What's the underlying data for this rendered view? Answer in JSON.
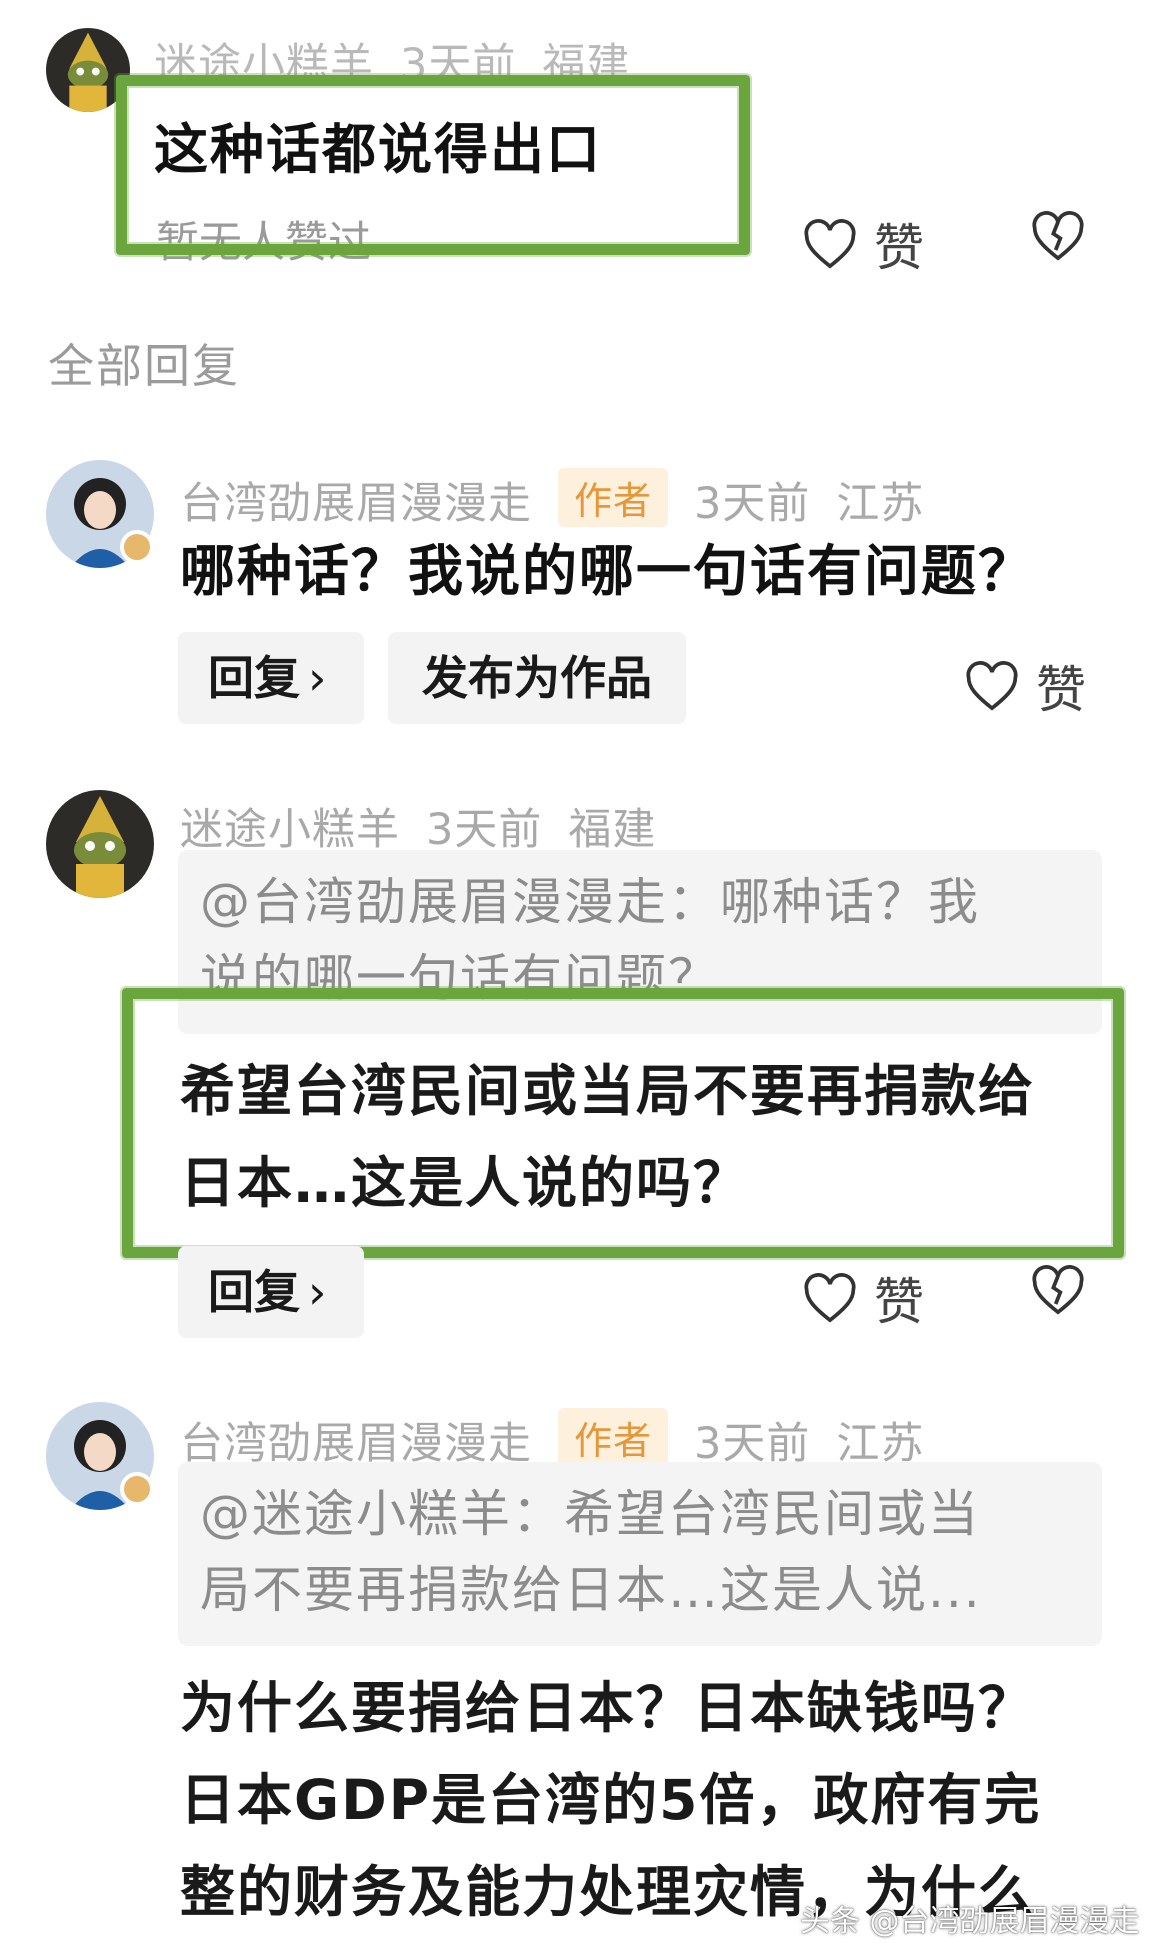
{
  "top_comment": {
    "user": "迷途小糕羊",
    "time": "3天前",
    "location": "福建",
    "text": "这种话都说得出口",
    "likes_text": "暂无人赞过",
    "like_label": "赞"
  },
  "section_title": "全部回复",
  "replies": [
    {
      "user": "台湾劭展眉漫漫走",
      "tag": "作者",
      "time": "3天前",
      "location": "江苏",
      "text": "哪种话？我说的哪一句话有问题？",
      "reply_label": "回复",
      "publish_label": "发布为作品",
      "like_label": "赞"
    },
    {
      "user": "迷途小糕羊",
      "time": "3天前",
      "location": "福建",
      "quote_line1": "@台湾劭展眉漫漫走：哪种话？我",
      "quote_line2": "说的哪一句话有问题？",
      "text_line1": "希望台湾民间或当局不要再捐款给",
      "text_line2": "日本…这是人说的吗？",
      "reply_label": "回复",
      "like_label": "赞"
    },
    {
      "user": "台湾劭展眉漫漫走",
      "tag": "作者",
      "time": "3天前",
      "location": "江苏",
      "quote_line1": "@迷途小糕羊：希望台湾民间或当",
      "quote_line2": "局不要再捐款给日本…这是人说...",
      "text_line1": "为什么要捐给日本？日本缺钱吗？",
      "text_line2": "日本GDP是台湾的5倍，政府有完",
      "text_line3": "整的财务及能力处理灾情，为什么"
    }
  ],
  "watermark": "头条 @台湾劭展眉漫漫走",
  "colors": {
    "highlight_box": "#6aa53e",
    "author_tag_bg": "#fdf0dc",
    "author_tag_text": "#e6973a"
  },
  "icons": [
    "heart-icon",
    "broken-heart-icon",
    "chevron-right-icon"
  ]
}
